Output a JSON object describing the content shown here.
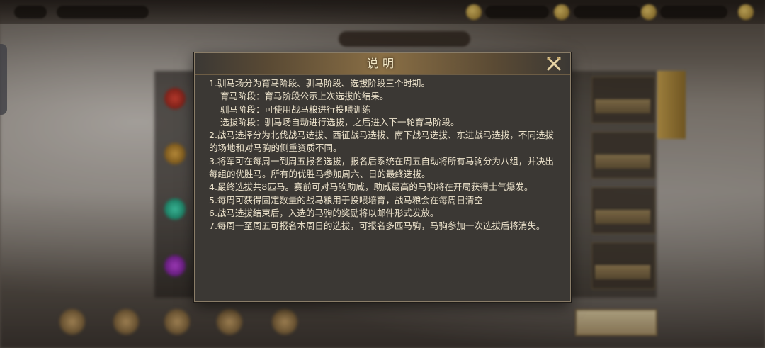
{
  "dialog": {
    "title": "说明",
    "lines": [
      {
        "text": "1.驯马场分为育马阶段、驯马阶段、选拔阶段三个时期。",
        "indent": false
      },
      {
        "text": "育马阶段：育马阶段公示上次选拔的结果。",
        "indent": true
      },
      {
        "text": "驯马阶段：可使用战马粮进行投喂训练",
        "indent": true
      },
      {
        "text": "选拔阶段：驯马场自动进行选拔，之后进入下一轮育马阶段。",
        "indent": true
      },
      {
        "text": "2.战马选择分为北伐战马选拔、西征战马选拔、南下战马选拔、东进战马选拔，不同选拔的场地和对马驹的侧重资质不同。",
        "indent": false
      },
      {
        "text": "3.将军可在每周一到周五报名选拔，报名后系统在周五自动将所有马驹分为八组，并决出每组的优胜马。所有的优胜马参加周六、日的最终选拔。",
        "indent": false
      },
      {
        "text": "4.最终选拔共8匹马。赛前可对马驹助威，助威最高的马驹将在开局获得士气爆发。",
        "indent": false
      },
      {
        "text": "5.每周可获得固定数量的战马粮用于投喂培育，战马粮会在每周日清空",
        "indent": false
      },
      {
        "text": "6.战马选拔结束后，入选的马驹的奖励将以邮件形式发放。",
        "indent": false
      },
      {
        "text": "7.每周一至周五可报名本周日的选拔，可报名多匹马驹，马驹参加一次选拔后将消失。",
        "indent": false
      }
    ]
  },
  "icons": {
    "close": "close-x-icon"
  },
  "colors": {
    "dialog_bg": "#3b3834",
    "title_text": "#f4e9c8",
    "body_text": "#ede3cc",
    "header_gold": "#8a6f45"
  }
}
